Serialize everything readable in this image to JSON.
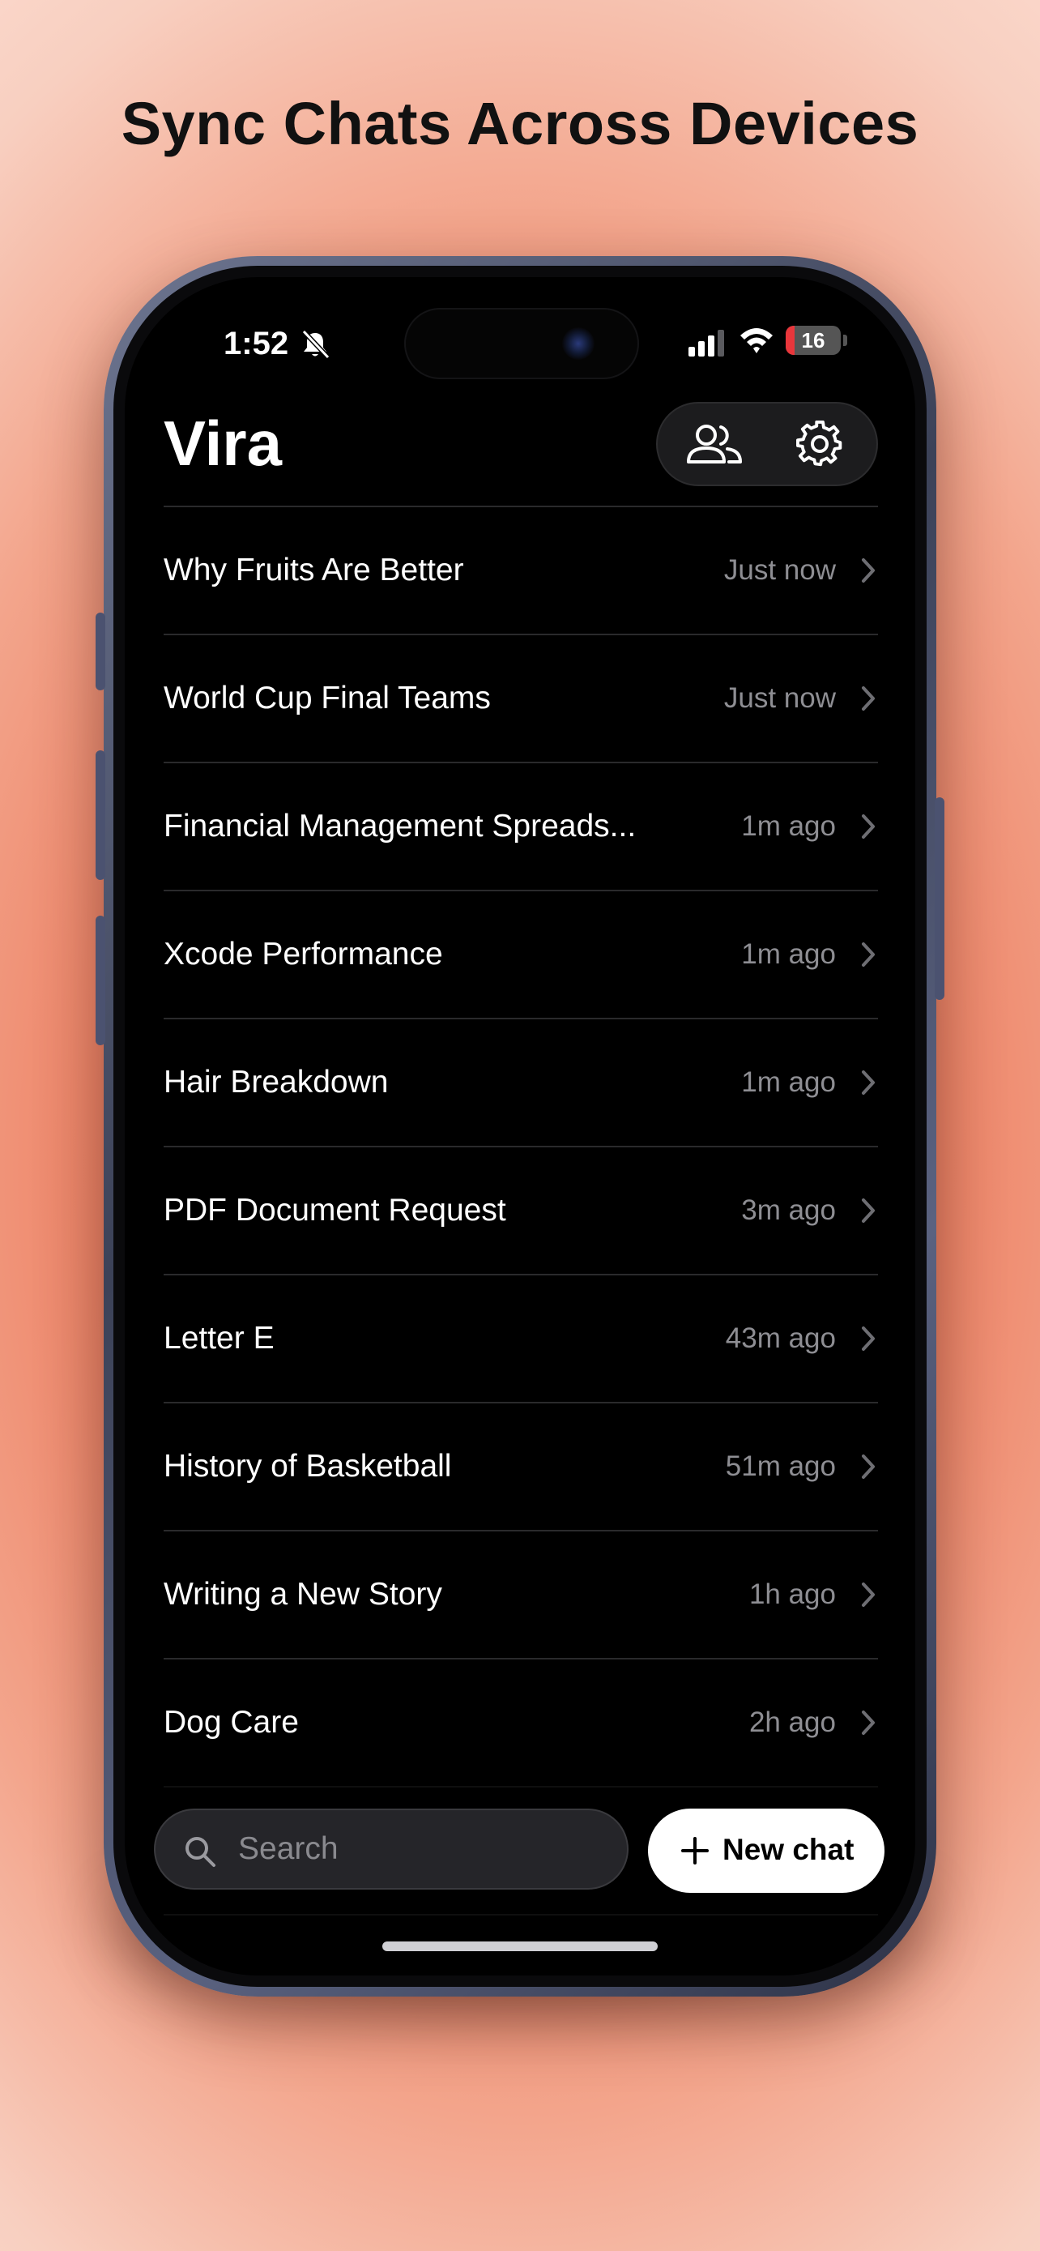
{
  "headline": "Sync Chats Across Devices",
  "status_bar": {
    "time": "1:52",
    "battery_level": "16",
    "battery_percent": 16
  },
  "app": {
    "title": "Vira",
    "header_icons": [
      "people-icon",
      "gear-icon"
    ]
  },
  "chats": [
    {
      "title": "Why Fruits Are Better",
      "time": "Just now"
    },
    {
      "title": "World Cup Final Teams",
      "time": "Just now"
    },
    {
      "title": "Financial Management Spreads...",
      "time": "1m ago"
    },
    {
      "title": "Xcode Performance",
      "time": "1m ago"
    },
    {
      "title": "Hair Breakdown",
      "time": "1m ago"
    },
    {
      "title": "PDF Document Request",
      "time": "3m ago"
    },
    {
      "title": "Letter E",
      "time": "43m ago"
    },
    {
      "title": "History of Basketball",
      "time": "51m ago"
    },
    {
      "title": "Writing a New Story",
      "time": "1h ago"
    },
    {
      "title": "Dog Care",
      "time": "2h ago"
    }
  ],
  "search": {
    "placeholder": "Search"
  },
  "new_chat": {
    "label": "New chat"
  },
  "colors": {
    "accent_battery": "#e9363b",
    "screen_background": "#000000",
    "secondary_text": "#8e8e93"
  }
}
